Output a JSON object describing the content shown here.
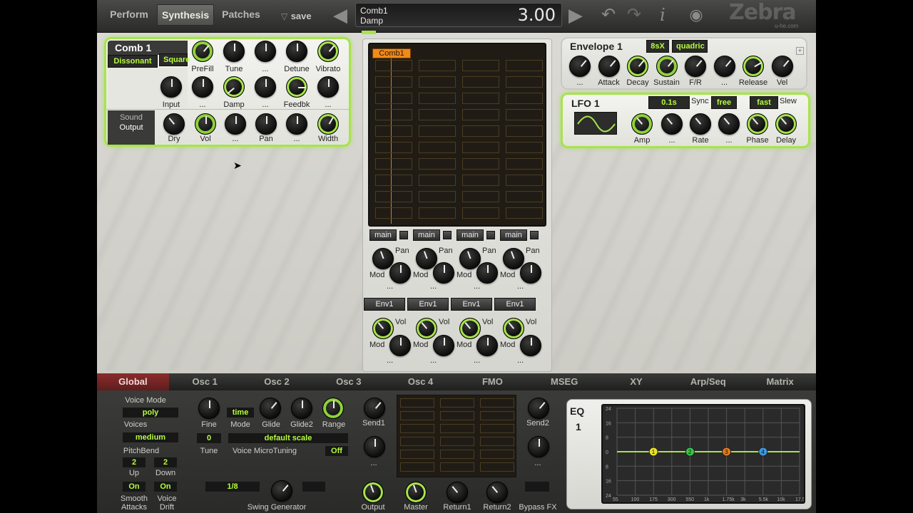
{
  "top": {
    "tabs": [
      "Perform",
      "Synthesis",
      "Patches"
    ],
    "save": "save",
    "lcd_line1": "Comb1",
    "lcd_line2": "Damp",
    "lcd_value": "3.00",
    "brand": "Zebra",
    "brand_sub": "u-he.com"
  },
  "comb": {
    "title": "Comb 1",
    "mode1": "Dissonant",
    "mode2": "Square",
    "row1": [
      "PreFill",
      "Tune",
      "...",
      "Detune",
      "Vibrato"
    ],
    "row2": [
      "Input",
      "...",
      "Damp",
      "...",
      "Feedbk",
      "..."
    ],
    "out_sound": "Sound",
    "out_output": "Output",
    "row3": [
      "Dry",
      "Vol",
      "...",
      "Pan",
      "...",
      "Width"
    ]
  },
  "env": {
    "title": "Envelope",
    "num": "1",
    "tag1": "8sX",
    "tag2": "quadric",
    "labels": [
      "...",
      "Attack",
      "Decay",
      "Sustain",
      "F/R",
      "...",
      "Release",
      "Vel"
    ]
  },
  "lfo": {
    "title": "LFO",
    "num": "1",
    "rate_tag": "0.1s",
    "sync": "Sync",
    "free": "free",
    "fast": "fast",
    "slew": "Slew",
    "labels": [
      "Amp",
      "...",
      "Rate",
      "...",
      "Phase",
      "Delay"
    ]
  },
  "matrix": {
    "tag": "Comb1",
    "bus": "main",
    "pan": "Pan",
    "mod": "Mod",
    "env": "Env1",
    "vol": "Vol",
    "dots": "..."
  },
  "bottom_tabs": [
    "Global",
    "Osc 1",
    "Osc 2",
    "Osc 3",
    "Osc 4",
    "FMO",
    "MSEG",
    "XY",
    "Arp/Seq",
    "Matrix"
  ],
  "global": {
    "voice_mode_label": "Voice Mode",
    "voice_mode": "poly",
    "voices_label": "Voices",
    "voices": "medium",
    "pitchbend_label": "PitchBend",
    "up": "2",
    "down": "2",
    "up_label": "Up",
    "down_label": "Down",
    "smooth": "On",
    "smooth_label1": "Smooth",
    "smooth_label2": "Attacks",
    "drift": "On",
    "drift_label1": "Voice",
    "drift_label2": "Drift",
    "fine": "Fine",
    "mode_val": "time",
    "mode": "Mode",
    "glide": "Glide",
    "glide2": "Glide2",
    "range": "Range",
    "send1": "Send1",
    "send2": "Send2",
    "dots": "...",
    "tune_val": "0",
    "tune": "Tune",
    "scale": "default scale",
    "microtuning": "Voice MicroTuning",
    "micro_val": "Off",
    "swing_val": "1/8",
    "swing": "Swing Generator",
    "output": "Output",
    "master": "Master",
    "return1": "Return1",
    "return2": "Return2",
    "bypass": "Bypass FX"
  },
  "eq": {
    "title": "EQ",
    "num": "1",
    "db": [
      "24",
      "16",
      "8",
      "0",
      "8",
      "16",
      "24"
    ],
    "freqs": [
      "55",
      "100",
      "175",
      "300",
      "550",
      "1k",
      "1.75k",
      "3k",
      "5.5k",
      "10k",
      "17.5"
    ],
    "bands": [
      "1",
      "2",
      "3",
      "4"
    ],
    "band_colors": [
      "#e8e030",
      "#39c64a",
      "#e07a22",
      "#3a9ae0"
    ]
  }
}
